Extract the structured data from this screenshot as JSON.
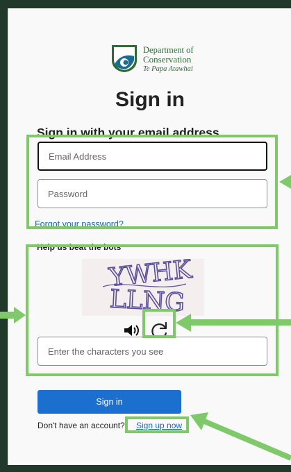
{
  "brand": {
    "line1": "Department of",
    "line2": "Conservation",
    "line3": "Te Papa Atawhai"
  },
  "page": {
    "title": "Sign in",
    "subtitle": "Sign in with your email address"
  },
  "form": {
    "email_placeholder": "Email Address",
    "password_placeholder": "Password",
    "forgot_link": "Forgot your password?",
    "captcha_heading": "Help us beat the bots",
    "captcha_input_placeholder": "Enter the characters you see",
    "captcha_text_line1": "YWHK",
    "captcha_text_line2": "LLNG",
    "signin_label": "Sign in",
    "no_account_text": "Don't have an account?",
    "signup_link": "Sign up now"
  },
  "icons": {
    "speaker": "speaker-icon",
    "refresh": "refresh-icon"
  },
  "colors": {
    "accent": "#1a6fcf",
    "link": "#1867c0",
    "highlight": "#7fc96b",
    "background": "#20392a",
    "brand_green": "#2e6b35"
  }
}
